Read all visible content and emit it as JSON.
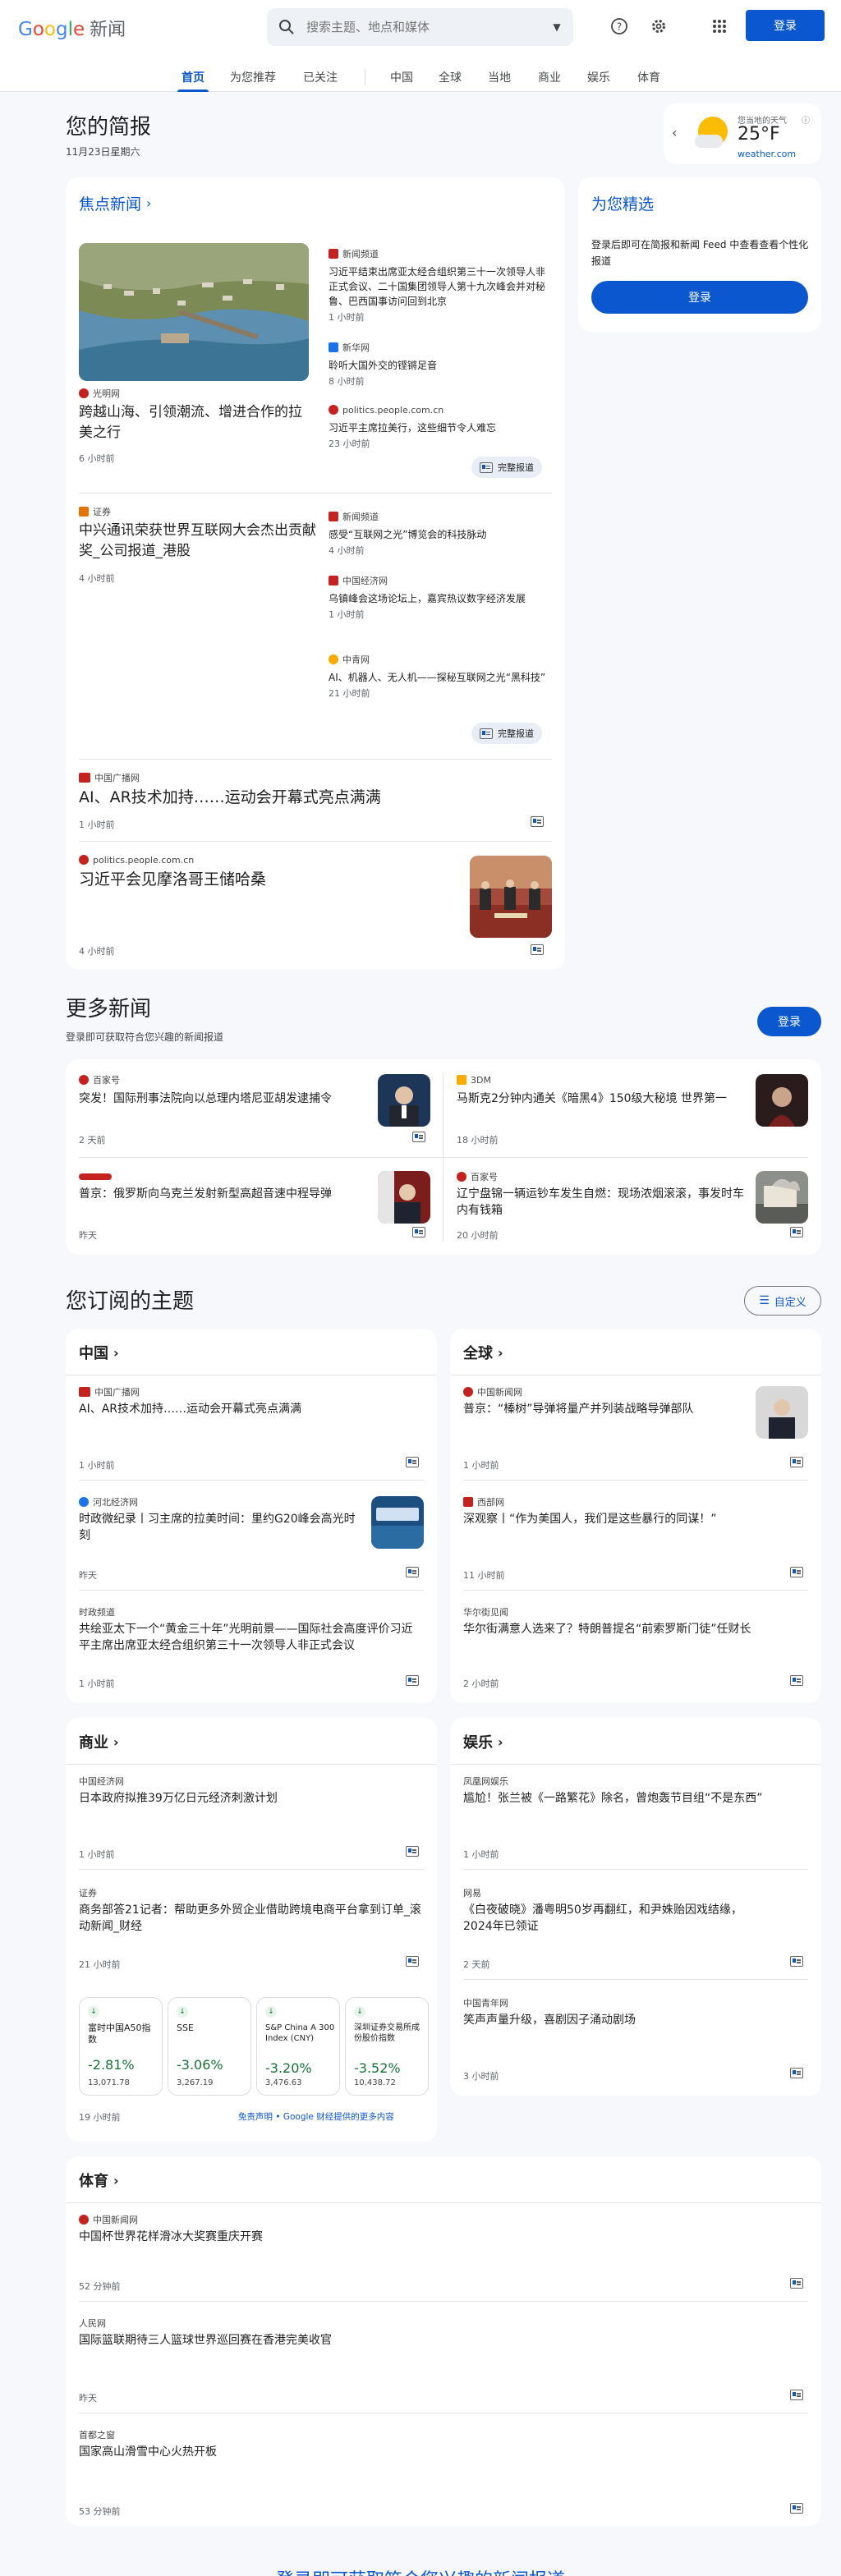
{
  "header": {
    "logo": "Google",
    "product": "新闻",
    "search_placeholder": "搜索主题、地点和媒体",
    "login": "登录"
  },
  "tabs": [
    "首页",
    "为您推荐",
    "已关注",
    "中国",
    "全球",
    "当地",
    "商业",
    "娱乐",
    "体育"
  ],
  "briefing": {
    "title": "您的简报",
    "date": "11月23日星期六",
    "weather_label": "您当地的天气",
    "temp": "25°F",
    "weather_source": "weather.com"
  },
  "personal": {
    "title": "为您精选",
    "desc": "登录后即可在简报和新闻 Feed 中查看查看个性化报道",
    "login": "登录"
  },
  "top": {
    "header": "焦点新闻",
    "full": "完整报道",
    "c1": {
      "main_source": "光明网",
      "main_title": "跨越山海、引领潮流、增进合作的拉美之行",
      "main_time": "6 小时前",
      "s1_source": "新闻频道",
      "s1_title": "习近平结束出席亚太经合组织第三十一次领导人非正式会议、二十国集团领导人第十九次峰会并对秘鲁、巴西国事访问回到北京",
      "s1_time": "1 小时前",
      "s2_source": "新华网",
      "s2_title": "聆听大国外交的铿锵足音",
      "s2_time": "8 小时前",
      "s3_source": "politics.people.com.cn",
      "s3_title": "习近平主席拉美行，这些细节令人难忘",
      "s3_time": "23 小时前"
    },
    "c2": {
      "main_source": "证券",
      "main_title": "中兴通讯荣获世界互联网大会杰出贡献奖_公司报道_港股",
      "main_time": "4 小时前",
      "s1_source": "新闻频道",
      "s1_title": "感受“互联网之光”博览会的科技脉动",
      "s1_time": "4 小时前",
      "s2_source": "中国经济网",
      "s2_title": "乌镇峰会这场论坛上，嘉宾热议数字经济发展",
      "s2_time": "1 小时前",
      "s3_source": "中青网",
      "s3_title": "AI、机器人、无人机——探秘互联网之光“黑科技”",
      "s3_time": "21 小时前"
    },
    "c3": {
      "source": "中国广播网",
      "title": "AI、AR技术加持……运动会开幕式亮点满满",
      "time": "1 小时前"
    },
    "c4": {
      "source": "politics.people.com.cn",
      "title": "习近平会见摩洛哥王储哈桑",
      "time": "4 小时前"
    }
  },
  "more": {
    "title": "更多新闻",
    "desc": "登录即可获取符合您兴趣的新闻报道",
    "login": "登录",
    "items": [
      {
        "source": "百家号",
        "title": "突发！国际刑事法院向以总理内塔尼亚胡发逮捕令",
        "time": "2 天前"
      },
      {
        "source": "3DM",
        "title": "马斯克2分钟内通关《暗黑4》150级大秘境 世界第一",
        "time": "18 小时前"
      },
      {
        "source": "",
        "title": "普京：俄罗斯向乌克兰发射新型高超音速中程导弹",
        "time": "昨天"
      },
      {
        "source": "百家号",
        "title": "辽宁盘锦一辆运钞车发生自燃：现场浓烟滚滚，事发时车内有钱箱",
        "time": "20 小时前"
      }
    ]
  },
  "topics": {
    "title": "您订阅的主题",
    "customize": "自定义",
    "china": {
      "label": "中国",
      "items": [
        {
          "source": "中国广播网",
          "title": "AI、AR技术加持……运动会开幕式亮点满满",
          "time": "1 小时前"
        },
        {
          "source": "河北经济网",
          "title": "时政微纪录丨习主席的拉美时间：里约G20峰会高光时刻",
          "time": "昨天"
        },
        {
          "source": "时政频道",
          "title": "共绘亚太下一个“黄金三十年”光明前景——国际社会高度评价习近平主席出席亚太经合组织第三十一次领导人非正式会议",
          "time": "1 小时前"
        }
      ]
    },
    "global": {
      "label": "全球",
      "items": [
        {
          "source": "中国新闻网",
          "title": "普京：“榛树”导弹将量产并列装战略导弹部队",
          "time": "1 小时前"
        },
        {
          "source": "西部网",
          "title": "深观察丨“作为美国人，我们是这些暴行的同谋！”",
          "time": "11 小时前"
        },
        {
          "source": "华尔街见闻",
          "title": "华尔街满意人选来了？特朗普提名“前索罗斯门徒”任财长",
          "time": "2 小时前"
        }
      ]
    },
    "business": {
      "label": "商业",
      "items": [
        {
          "source": "中国经济网",
          "title": "日本政府拟推39万亿日元经济刺激计划",
          "time": "1 小时前"
        },
        {
          "source": "证券",
          "title": "商务部答21记者：帮助更多外贸企业借助跨境电商平台拿到订单_滚动新闻_财经",
          "time": "21 小时前"
        }
      ],
      "stocks": [
        {
          "name": "富时中国A50指数",
          "pct": "-2.81%",
          "value": "13,071.78"
        },
        {
          "name": "SSE",
          "pct": "-3.06%",
          "value": "3,267.19"
        },
        {
          "name": "S&P China A 300 Index (CNY)",
          "pct": "-3.20%",
          "value": "3,476.63"
        },
        {
          "name": "深圳证券交易所成份股价指数",
          "pct": "-3.52%",
          "value": "10,438.72"
        }
      ],
      "stocks_time": "19 小时前",
      "disclaimer": "免责声明 • Google 财经提供的更多内容"
    },
    "entertainment": {
      "label": "娱乐",
      "items": [
        {
          "source": "凤凰网娱乐",
          "title": "尴尬！张兰被《一路繁花》除名，曾炮轰节目组“不是东西”",
          "time": "1 小时前"
        },
        {
          "source": "网易",
          "title": "《白夜破晓》潘粤明50岁再翻红，和尹姝贻因戏结缘，2024年已领证",
          "time": "2 天前"
        },
        {
          "source": "中国青年网",
          "title": "笑声声量升级，喜剧因子涌动剧场",
          "time": "3 小时前"
        }
      ]
    },
    "sports": {
      "label": "体育",
      "items": [
        {
          "source": "中国新闻网",
          "title": "中国杯世界花样滑冰大奖赛重庆开赛",
          "time": "52 分钟前"
        },
        {
          "source": "人民网",
          "title": "国际篮联期待三人篮球世界巡回赛在香港完美收官",
          "time": "昨天"
        },
        {
          "source": "首都之窗",
          "title": "国家高山滑雪中心火热开板",
          "time": "53 分钟前"
        }
      ]
    }
  },
  "footer": {
    "text": "登录即可获取符合您兴趣的新闻报道"
  }
}
